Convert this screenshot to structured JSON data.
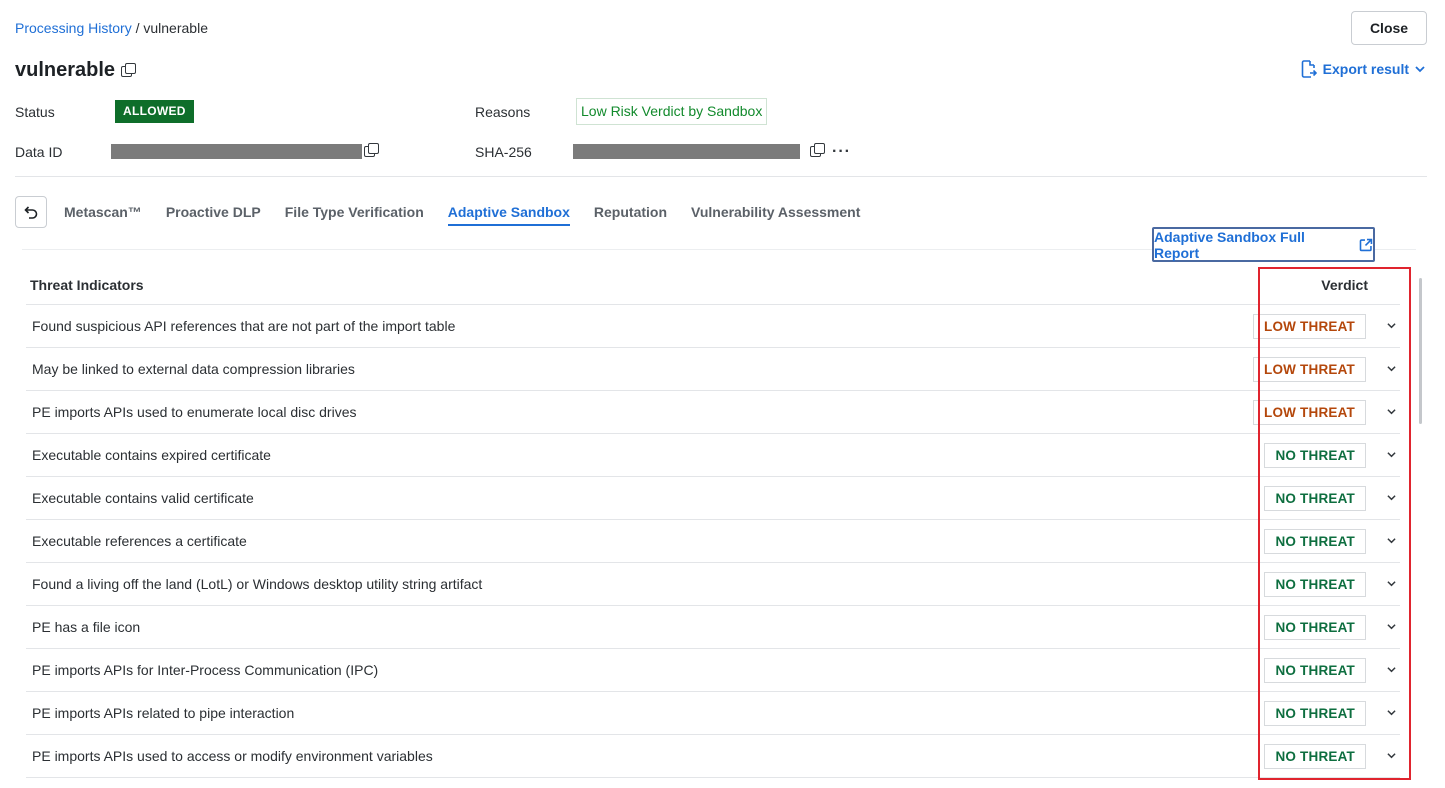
{
  "breadcrumb": {
    "parent": "Processing History",
    "separator": "/",
    "current": "vulnerable"
  },
  "header": {
    "close_label": "Close",
    "title": "vulnerable",
    "export_label": "Export result"
  },
  "meta": {
    "status_label": "Status",
    "status_value": "ALLOWED",
    "reasons_label": "Reasons",
    "reasons_value": "Low Risk Verdict by Sandbox",
    "data_id_label": "Data ID",
    "sha_label": "SHA-256"
  },
  "tabs": [
    {
      "label": "Metascan™",
      "active": false
    },
    {
      "label": "Proactive DLP",
      "active": false
    },
    {
      "label": "File Type Verification",
      "active": false
    },
    {
      "label": "Adaptive Sandbox",
      "active": true
    },
    {
      "label": "Reputation",
      "active": false
    },
    {
      "label": "Vulnerability Assessment",
      "active": false
    }
  ],
  "sandbox": {
    "full_report_label": "Adaptive Sandbox Full Report",
    "col_indicators": "Threat Indicators",
    "col_verdict": "Verdict",
    "rows": [
      {
        "indicator": "Found suspicious API references that are not part of the import table",
        "verdict": "LOW THREAT",
        "level": "low"
      },
      {
        "indicator": "May be linked to external data compression libraries",
        "verdict": "LOW THREAT",
        "level": "low"
      },
      {
        "indicator": "PE imports APIs used to enumerate local disc drives",
        "verdict": "LOW THREAT",
        "level": "low"
      },
      {
        "indicator": "Executable contains expired certificate",
        "verdict": "NO THREAT",
        "level": "none"
      },
      {
        "indicator": "Executable contains valid certificate",
        "verdict": "NO THREAT",
        "level": "none"
      },
      {
        "indicator": "Executable references a certificate",
        "verdict": "NO THREAT",
        "level": "none"
      },
      {
        "indicator": "Found a living off the land (LotL) or Windows desktop utility string artifact",
        "verdict": "NO THREAT",
        "level": "none"
      },
      {
        "indicator": "PE has a file icon",
        "verdict": "NO THREAT",
        "level": "none"
      },
      {
        "indicator": "PE imports APIs for Inter-Process Communication (IPC)",
        "verdict": "NO THREAT",
        "level": "none"
      },
      {
        "indicator": "PE imports APIs related to pipe interaction",
        "verdict": "NO THREAT",
        "level": "none"
      },
      {
        "indicator": "PE imports APIs used to access or modify environment variables",
        "verdict": "NO THREAT",
        "level": "none"
      }
    ]
  },
  "colors": {
    "accent": "#1f6fd6",
    "allowed": "#0e6e2a",
    "low_threat": "#b4470b",
    "no_threat": "#0d6e3f",
    "highlight": "#e0242e"
  }
}
